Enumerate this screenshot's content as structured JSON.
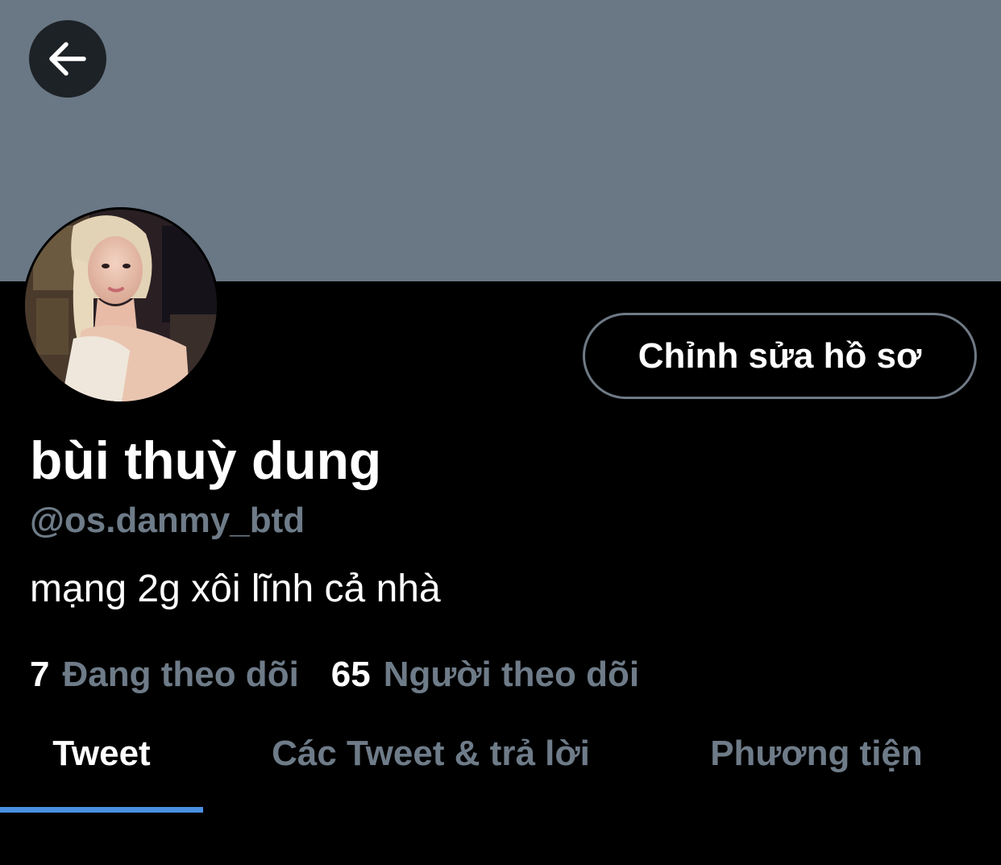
{
  "header": {
    "back_icon": "arrow-left-icon",
    "banner_color": "#6a7886"
  },
  "profile": {
    "avatar_icon": "profile-photo",
    "edit_button_label": "Chỉnh sửa hồ sơ",
    "display_name": "bùi thuỳ dung",
    "handle": "@os.danmy_btd",
    "bio": "mạng 2g xôi lĩnh cả nhà",
    "following_count": "7",
    "following_label": "Đang theo dõi",
    "followers_count": "65",
    "followers_label": "Người theo dõi"
  },
  "tabs": [
    {
      "label": "Tweet",
      "active": true
    },
    {
      "label": "Các Tweet & trả lời",
      "active": false
    },
    {
      "label": "Phương tiện",
      "active": false
    }
  ],
  "colors": {
    "background": "#000000",
    "text_primary": "#ffffff",
    "text_secondary": "#6e7b88",
    "accent": "#4a90e2"
  }
}
